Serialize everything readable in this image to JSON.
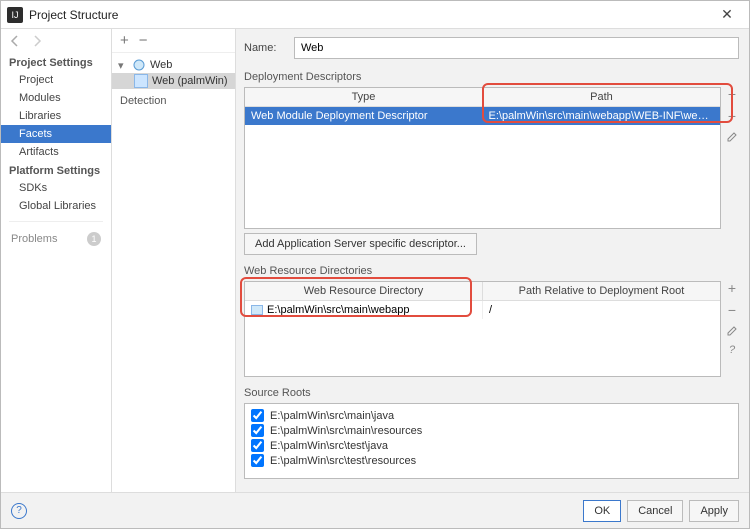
{
  "window": {
    "title": "Project Structure"
  },
  "sidebar": {
    "groups": [
      {
        "title": "Project Settings",
        "items": [
          "Project",
          "Modules",
          "Libraries",
          "Facets",
          "Artifacts"
        ],
        "selectedIndex": 3
      },
      {
        "title": "Platform Settings",
        "items": [
          "SDKs",
          "Global Libraries"
        ]
      }
    ],
    "problems": {
      "label": "Problems",
      "count": "1"
    }
  },
  "tree": {
    "root": "Web",
    "child": "Web (palmWin)",
    "detection": "Detection"
  },
  "main": {
    "name_label": "Name:",
    "name_value": "Web",
    "dd": {
      "title": "Deployment Descriptors",
      "col_type": "Type",
      "col_path": "Path",
      "row_type": "Web Module Deployment Descriptor",
      "row_path": "E:\\palmWin\\src\\main\\webapp\\WEB-INF\\web.xml",
      "add_button": "Add Application Server specific descriptor..."
    },
    "wrd": {
      "title": "Web Resource Directories",
      "col_dir": "Web Resource Directory",
      "col_rel": "Path Relative to Deployment Root",
      "row_dir": "E:\\palmWin\\src\\main\\webapp",
      "row_rel": "/"
    },
    "src": {
      "title": "Source Roots",
      "rows": [
        "E:\\palmWin\\src\\main\\java",
        "E:\\palmWin\\src\\main\\resources",
        "E:\\palmWin\\src\\test\\java",
        "E:\\palmWin\\src\\test\\resources"
      ]
    }
  },
  "footer": {
    "ok": "OK",
    "cancel": "Cancel",
    "apply": "Apply"
  },
  "colors": {
    "selection": "#3b78cc",
    "highlight": "#e24c3e"
  }
}
